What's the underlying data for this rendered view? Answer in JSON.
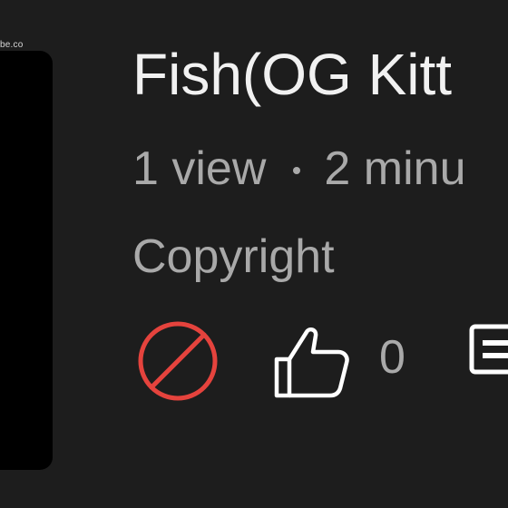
{
  "thumbnail": {
    "watermark": "be.co"
  },
  "video": {
    "title": "Fish(OG Kitt",
    "views": "1 view",
    "age": "2 minu",
    "restriction": "Copyright"
  },
  "actions": {
    "like_count": "0"
  },
  "colors": {
    "background": "#1d1d1d",
    "title": "#f1f1f1",
    "secondary_text": "#a9a9a9",
    "blocked_icon": "#e5433d",
    "icon": "#ffffff"
  },
  "icons": [
    "blocked-icon",
    "thumbs-up-icon",
    "comments-icon"
  ]
}
